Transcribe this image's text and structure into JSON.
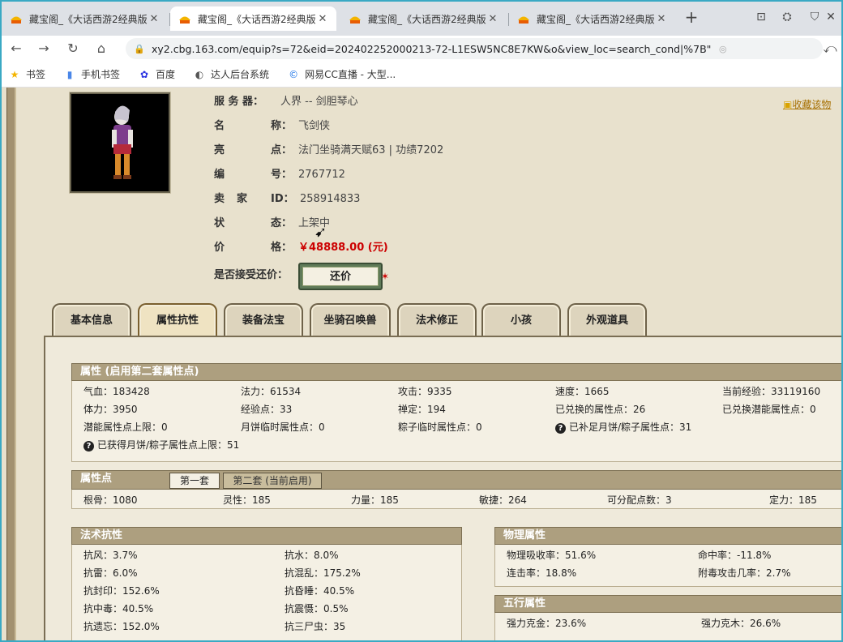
{
  "browser": {
    "tabs": [
      {
        "title": "藏宝阁_《大话西游2经典版"
      },
      {
        "title": "藏宝阁_《大话西游2经典版"
      },
      {
        "title": "藏宝阁_《大话西游2经典版"
      },
      {
        "title": "藏宝阁_《大话西游2经典版"
      }
    ],
    "active_tab": 1,
    "url": "xy2.cbg.163.com/equip?s=72&eid=202402252000213-72-L1ESW5NC8E7KW&o&view_loc=search_cond|%7B\"is_fro...",
    "bookmarks": [
      {
        "label": "书签",
        "icon": "star-icon"
      },
      {
        "label": "手机书签",
        "icon": "phone-icon"
      },
      {
        "label": "百度",
        "icon": "baidu-icon"
      },
      {
        "label": "达人后台系统",
        "icon": "edge-icon"
      },
      {
        "label": "网易CC直播 - 大型...",
        "icon": "cc-icon"
      }
    ]
  },
  "character": {
    "server_label": "服 务 器：",
    "server": "人界 -- 剑胆琴心",
    "name_label1": "名",
    "name_label2": "称：",
    "name": "飞剑侠",
    "highlight_label1": "亮",
    "highlight_label2": "点：",
    "highlight": "法门坐骑满天赋63 | 功绩7202",
    "number_label1": "编",
    "number_label2": "号：",
    "number": "2767712",
    "seller_label1": "卖",
    "seller_label2": "家",
    "seller_label3": "ID：",
    "seller_id": "258914833",
    "status_label1": "状",
    "status_label2": "态：",
    "status": "上架中",
    "price_label1": "价",
    "price_label2": "格：",
    "price": "￥48888.00 (元)",
    "bargain_label": "是否接受还价：",
    "bargain_button": "还价",
    "favorite": "收藏该物"
  },
  "game_tabs": [
    "基本信息",
    "属性抗性",
    "装备法宝",
    "坐骑召唤兽",
    "法术修正",
    "小孩",
    "外观道具"
  ],
  "active_game_tab": 1,
  "attributes": {
    "title": "属性 (启用第二套属性点)",
    "rows": [
      [
        "气血：183428",
        "法力：61534",
        "攻击：9335",
        "速度：1665",
        "当前经验：33119160"
      ],
      [
        "体力：3950",
        "经验点：33",
        "禅定：194",
        "已兑换的属性点：26",
        "已兑换潜能属性点：0"
      ],
      [
        "潜能属性点上限：0",
        "月饼临时属性点：0",
        "粽子临时属性点：0",
        "已补足月饼/粽子属性点：31"
      ]
    ],
    "footer": "已获得月饼/粽子属性点上限：51"
  },
  "points": {
    "title": "属性点",
    "tab1": "第一套",
    "tab2": "第二套 (当前启用)",
    "values": [
      "根骨：1080",
      "灵性：185",
      "力量：185",
      "敏捷：264",
      "可分配点数：3",
      "定力：185"
    ]
  },
  "resist": {
    "title": "法术抗性",
    "left": [
      "抗风：3.7%",
      "抗雷：6.0%",
      "抗封印：152.6%",
      "抗中毒：40.5%",
      "抗遗忘：152.0%"
    ],
    "right": [
      "抗水：8.0%",
      "抗混乱：175.2%",
      "抗昏睡：40.5%",
      "抗震慑：0.5%",
      "抗三尸虫：35"
    ]
  },
  "physical": {
    "title": "物理属性",
    "left": [
      "物理吸收率：51.6%",
      "连击率：18.8%"
    ],
    "right": [
      "命中率：-11.8%",
      "附毒攻击几率：2.7%"
    ]
  },
  "elements": {
    "title": "五行属性",
    "left": [
      "强力克金：23.6%"
    ],
    "right": [
      "强力克木：26.6%"
    ]
  }
}
